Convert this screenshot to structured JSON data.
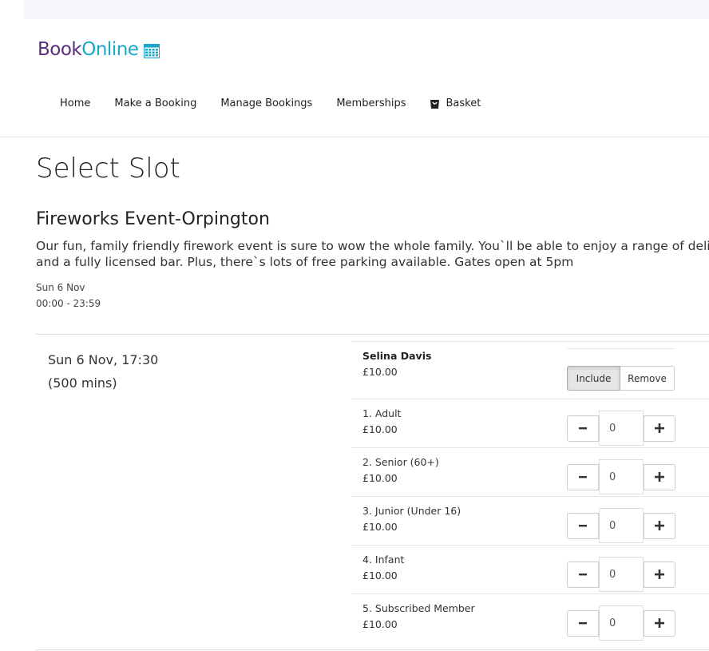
{
  "brand": {
    "book": "Book",
    "online": "Online",
    "book_color": "#5b2d7e",
    "online_color": "#1aa7c9",
    "icon": "calendar-icon"
  },
  "nav": {
    "home": "Home",
    "make_booking": "Make a Booking",
    "manage_bookings": "Manage Bookings",
    "memberships": "Memberships",
    "basket": "Basket",
    "basket_icon": "basket-icon"
  },
  "page": {
    "title": "Select Slot"
  },
  "event": {
    "title": "Fireworks Event-Orpington",
    "description_line1": "Our fun, family friendly firework event is sure to wow the whole family. You`ll be able to enjoy a range of delicious",
    "description_line2": "and a fully licensed bar. Plus, there`s lots of free parking available. Gates open at 5pm",
    "date": "Sun 6 Nov",
    "time": "00:00 - 23:59"
  },
  "slot": {
    "datetime": "Sun 6 Nov, 17:30",
    "duration": "(500 mins)"
  },
  "member": {
    "name": "Selina Davis",
    "price": "£10.00",
    "include_label": "Include",
    "remove_label": "Remove"
  },
  "tickets": [
    {
      "label": "1. Adult",
      "price": "£10.00",
      "qty": "0"
    },
    {
      "label": "2. Senior (60+)",
      "price": "£10.00",
      "qty": "0"
    },
    {
      "label": "3. Junior (Under 16)",
      "price": "£10.00",
      "qty": "0"
    },
    {
      "label": "4. Infant",
      "price": "£10.00",
      "qty": "0"
    },
    {
      "label": "5. Subscribed Member",
      "price": "£10.00",
      "qty": "0"
    }
  ]
}
